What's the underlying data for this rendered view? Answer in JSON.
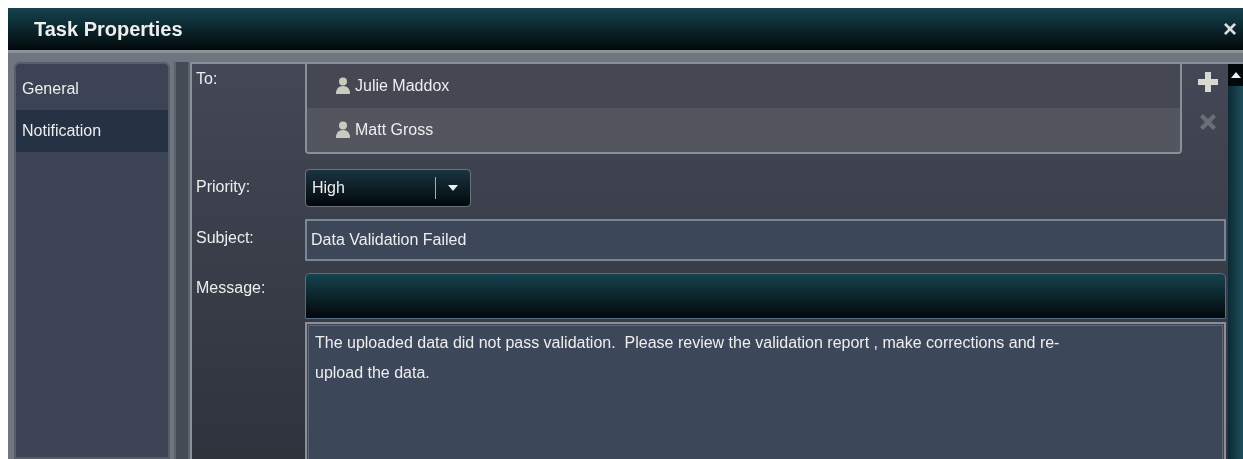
{
  "window": {
    "title": "Task Properties",
    "close": "×"
  },
  "sidebar": {
    "items": [
      {
        "label": "General",
        "selected": false
      },
      {
        "label": "Notification",
        "selected": true
      }
    ]
  },
  "form": {
    "to": {
      "label": "To:",
      "recipients": [
        {
          "name": "Julie Maddox",
          "selected": false
        },
        {
          "name": "Matt Gross",
          "selected": true
        }
      ],
      "remove_disabled": true
    },
    "priority": {
      "label": "Priority:",
      "value": "High"
    },
    "subject": {
      "label": "Subject:",
      "value": "Data Validation Failed"
    },
    "message": {
      "label": "Message:",
      "value": "The uploaded data did not pass validation.  Please review the validation report , make corrections and re-upload the data."
    }
  }
}
